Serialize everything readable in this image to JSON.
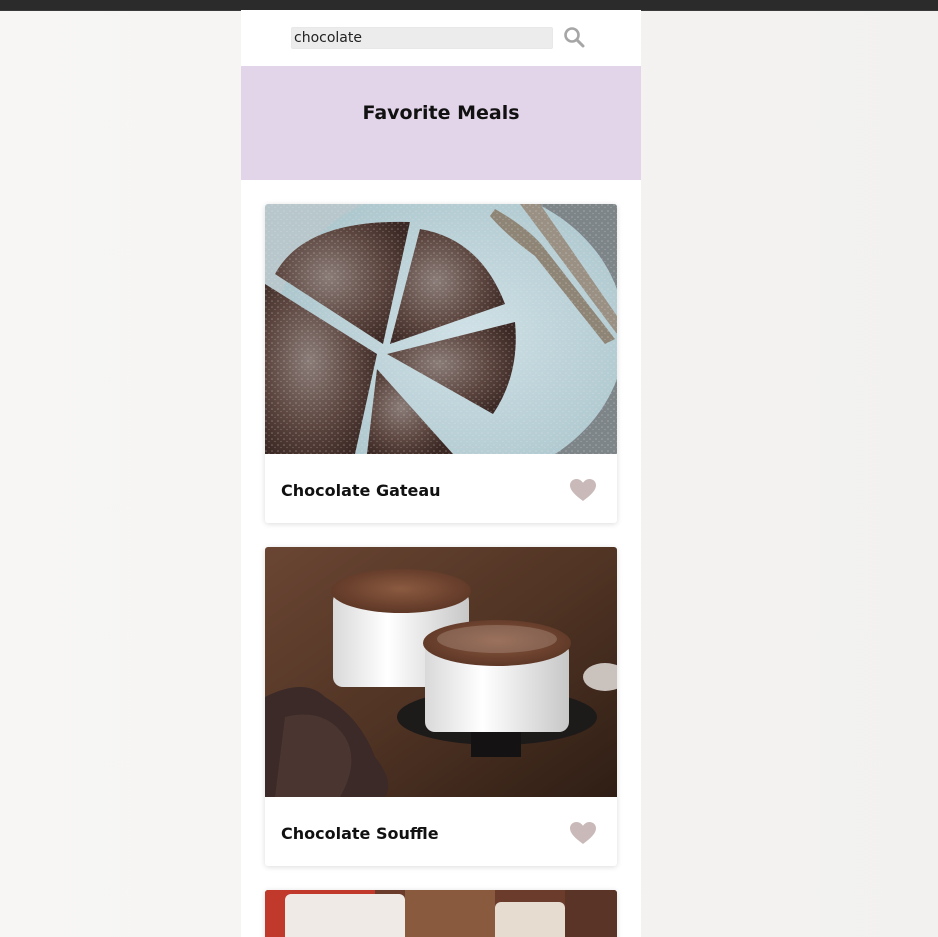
{
  "search": {
    "value": "chocolate",
    "icon": "search-icon"
  },
  "favorites": {
    "title": "Favorite Meals"
  },
  "meals": [
    {
      "name": "Chocolate Gateau",
      "favorited": true
    },
    {
      "name": "Chocolate Souffle",
      "favorited": true
    },
    {
      "name": ""
    }
  ],
  "colors": {
    "header_bg": "#e2d5e9",
    "heart": "#c9b9b9",
    "search_icon": "#a6a6a6"
  }
}
